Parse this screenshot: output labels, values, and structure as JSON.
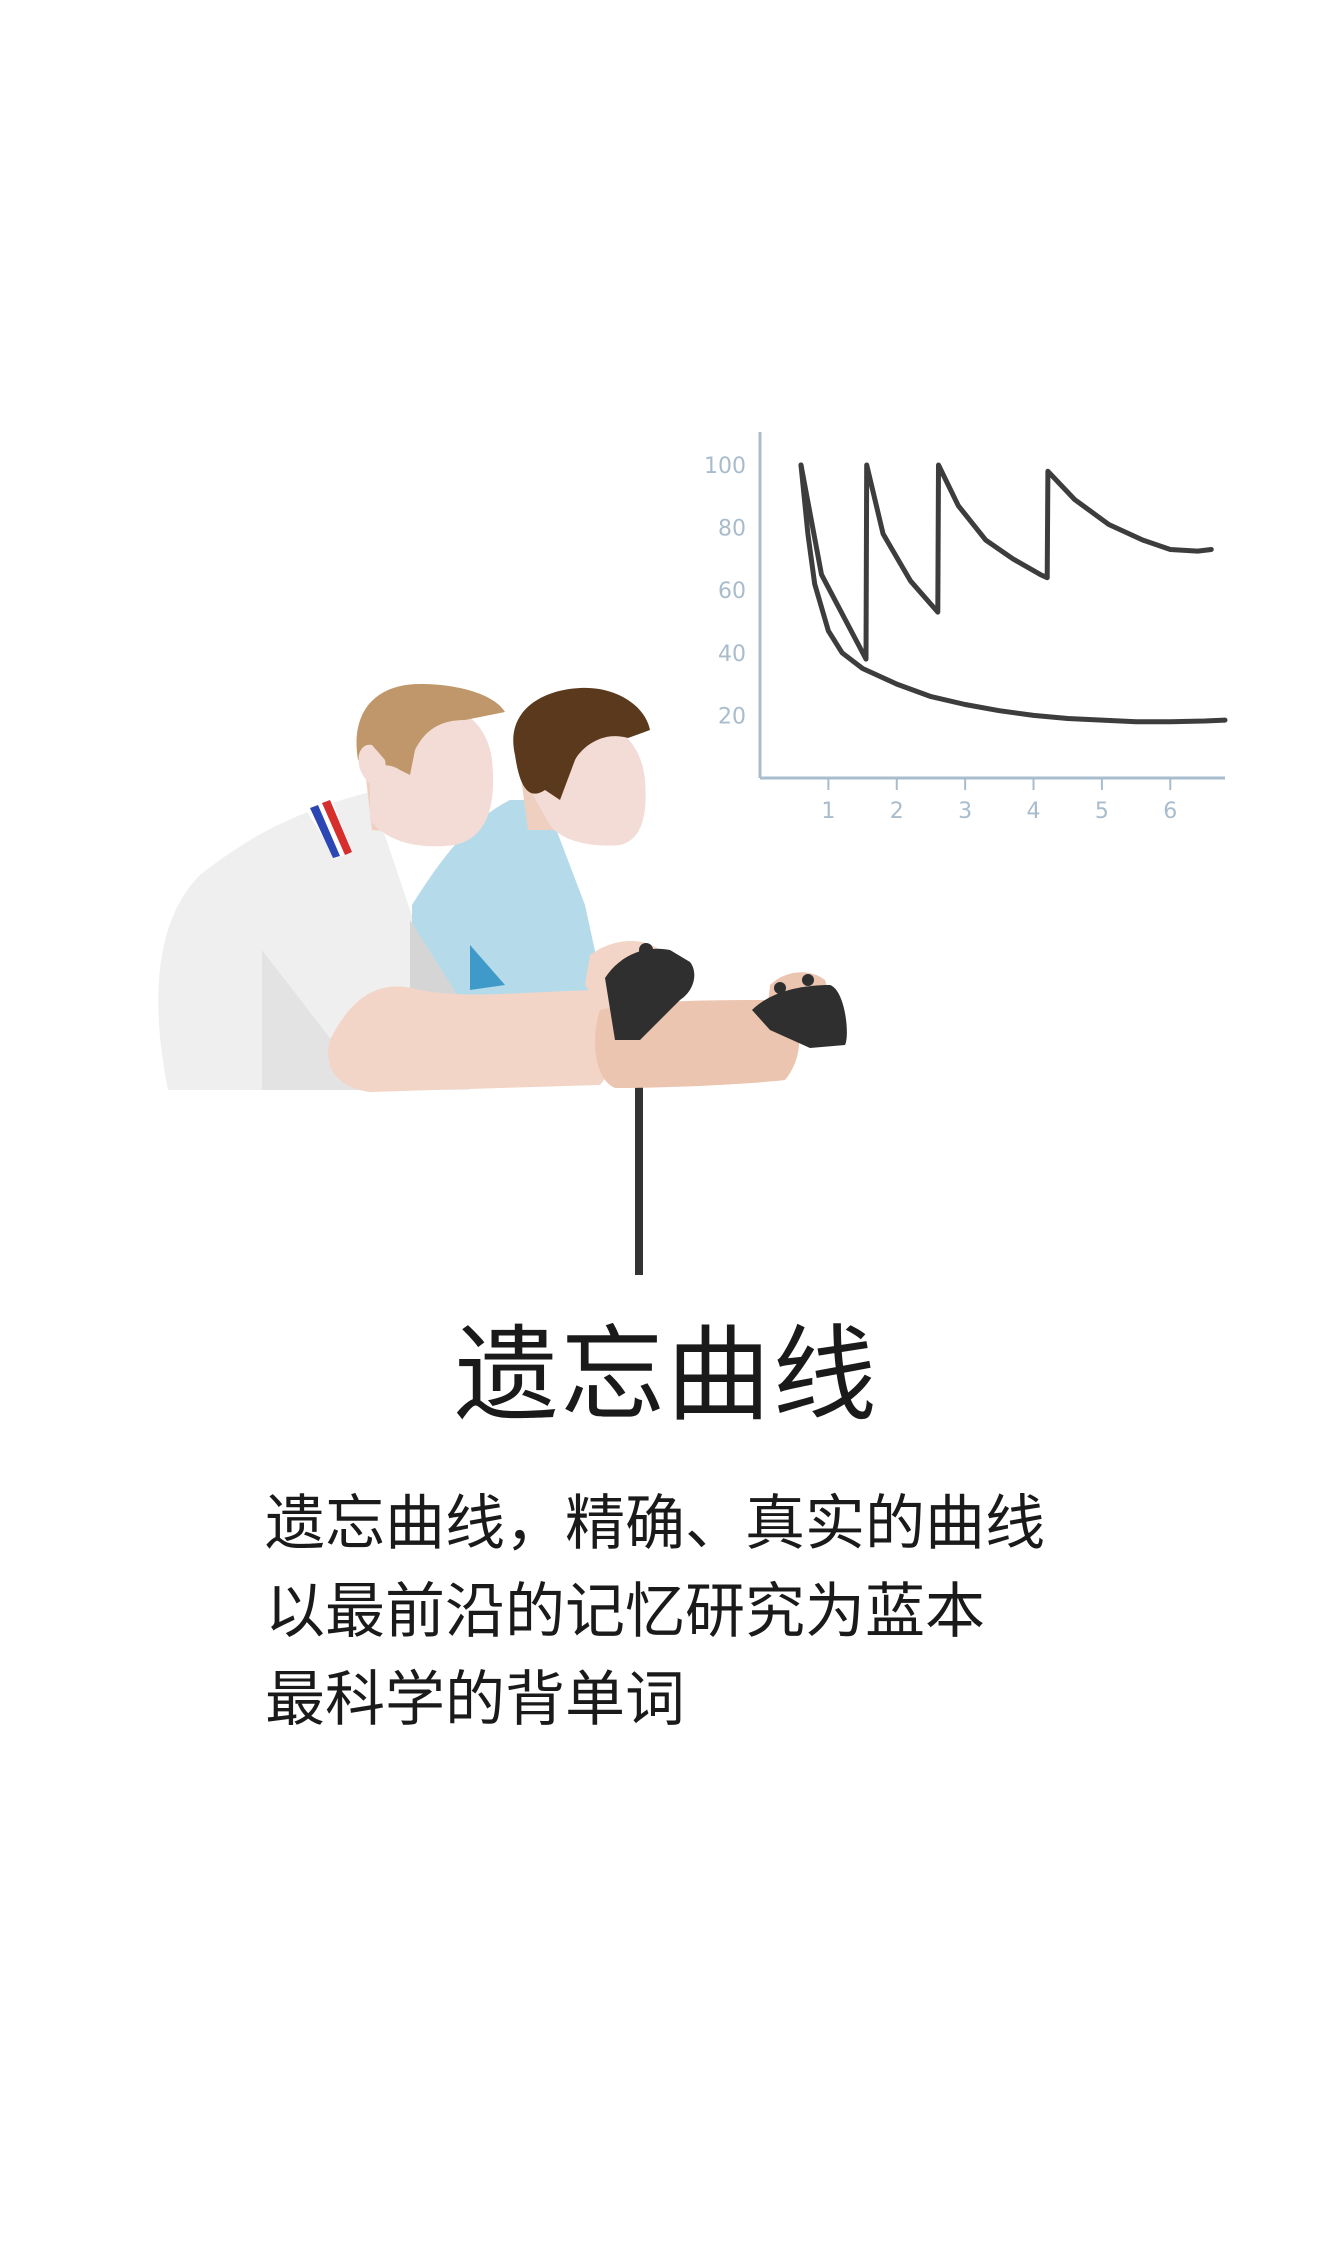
{
  "screen": {
    "title": "遗忘曲线",
    "body_lines": [
      "遗忘曲线，精确、真实的曲线",
      "以最前沿的记忆研究为蓝本",
      "最科学的背单词"
    ]
  },
  "chart_data": {
    "type": "line",
    "title": "",
    "xlabel": "",
    "ylabel": "",
    "x_ticks": [
      1,
      2,
      3,
      4,
      5,
      6
    ],
    "y_ticks": [
      20,
      40,
      60,
      80,
      100
    ],
    "xlim": [
      0,
      6.8
    ],
    "ylim": [
      0,
      108
    ],
    "series": [
      {
        "x": [
          0.6,
          0.7,
          0.8,
          1.0,
          1.2,
          1.5,
          2.0,
          2.5,
          3.0,
          3.5,
          4.0,
          4.5,
          5.0,
          5.5,
          6.0,
          6.5,
          6.8
        ],
        "y": [
          100,
          78,
          62,
          47,
          40,
          35,
          30,
          26,
          23.5,
          21.5,
          20,
          19,
          18.5,
          18,
          18,
          18.2,
          18.5
        ]
      },
      {
        "x": [
          0.6,
          0.9,
          1.55,
          1.56,
          1.8,
          2.2,
          2.6,
          2.61,
          2.9,
          3.3,
          3.7,
          4.1,
          4.2,
          4.21,
          4.6,
          5.1,
          5.6,
          6.0,
          6.4,
          6.6
        ],
        "y": [
          100,
          65,
          38,
          100,
          78,
          63,
          53,
          100,
          87,
          76,
          70,
          65,
          64,
          98,
          89,
          81,
          76,
          73,
          72.5,
          73
        ]
      }
    ]
  }
}
